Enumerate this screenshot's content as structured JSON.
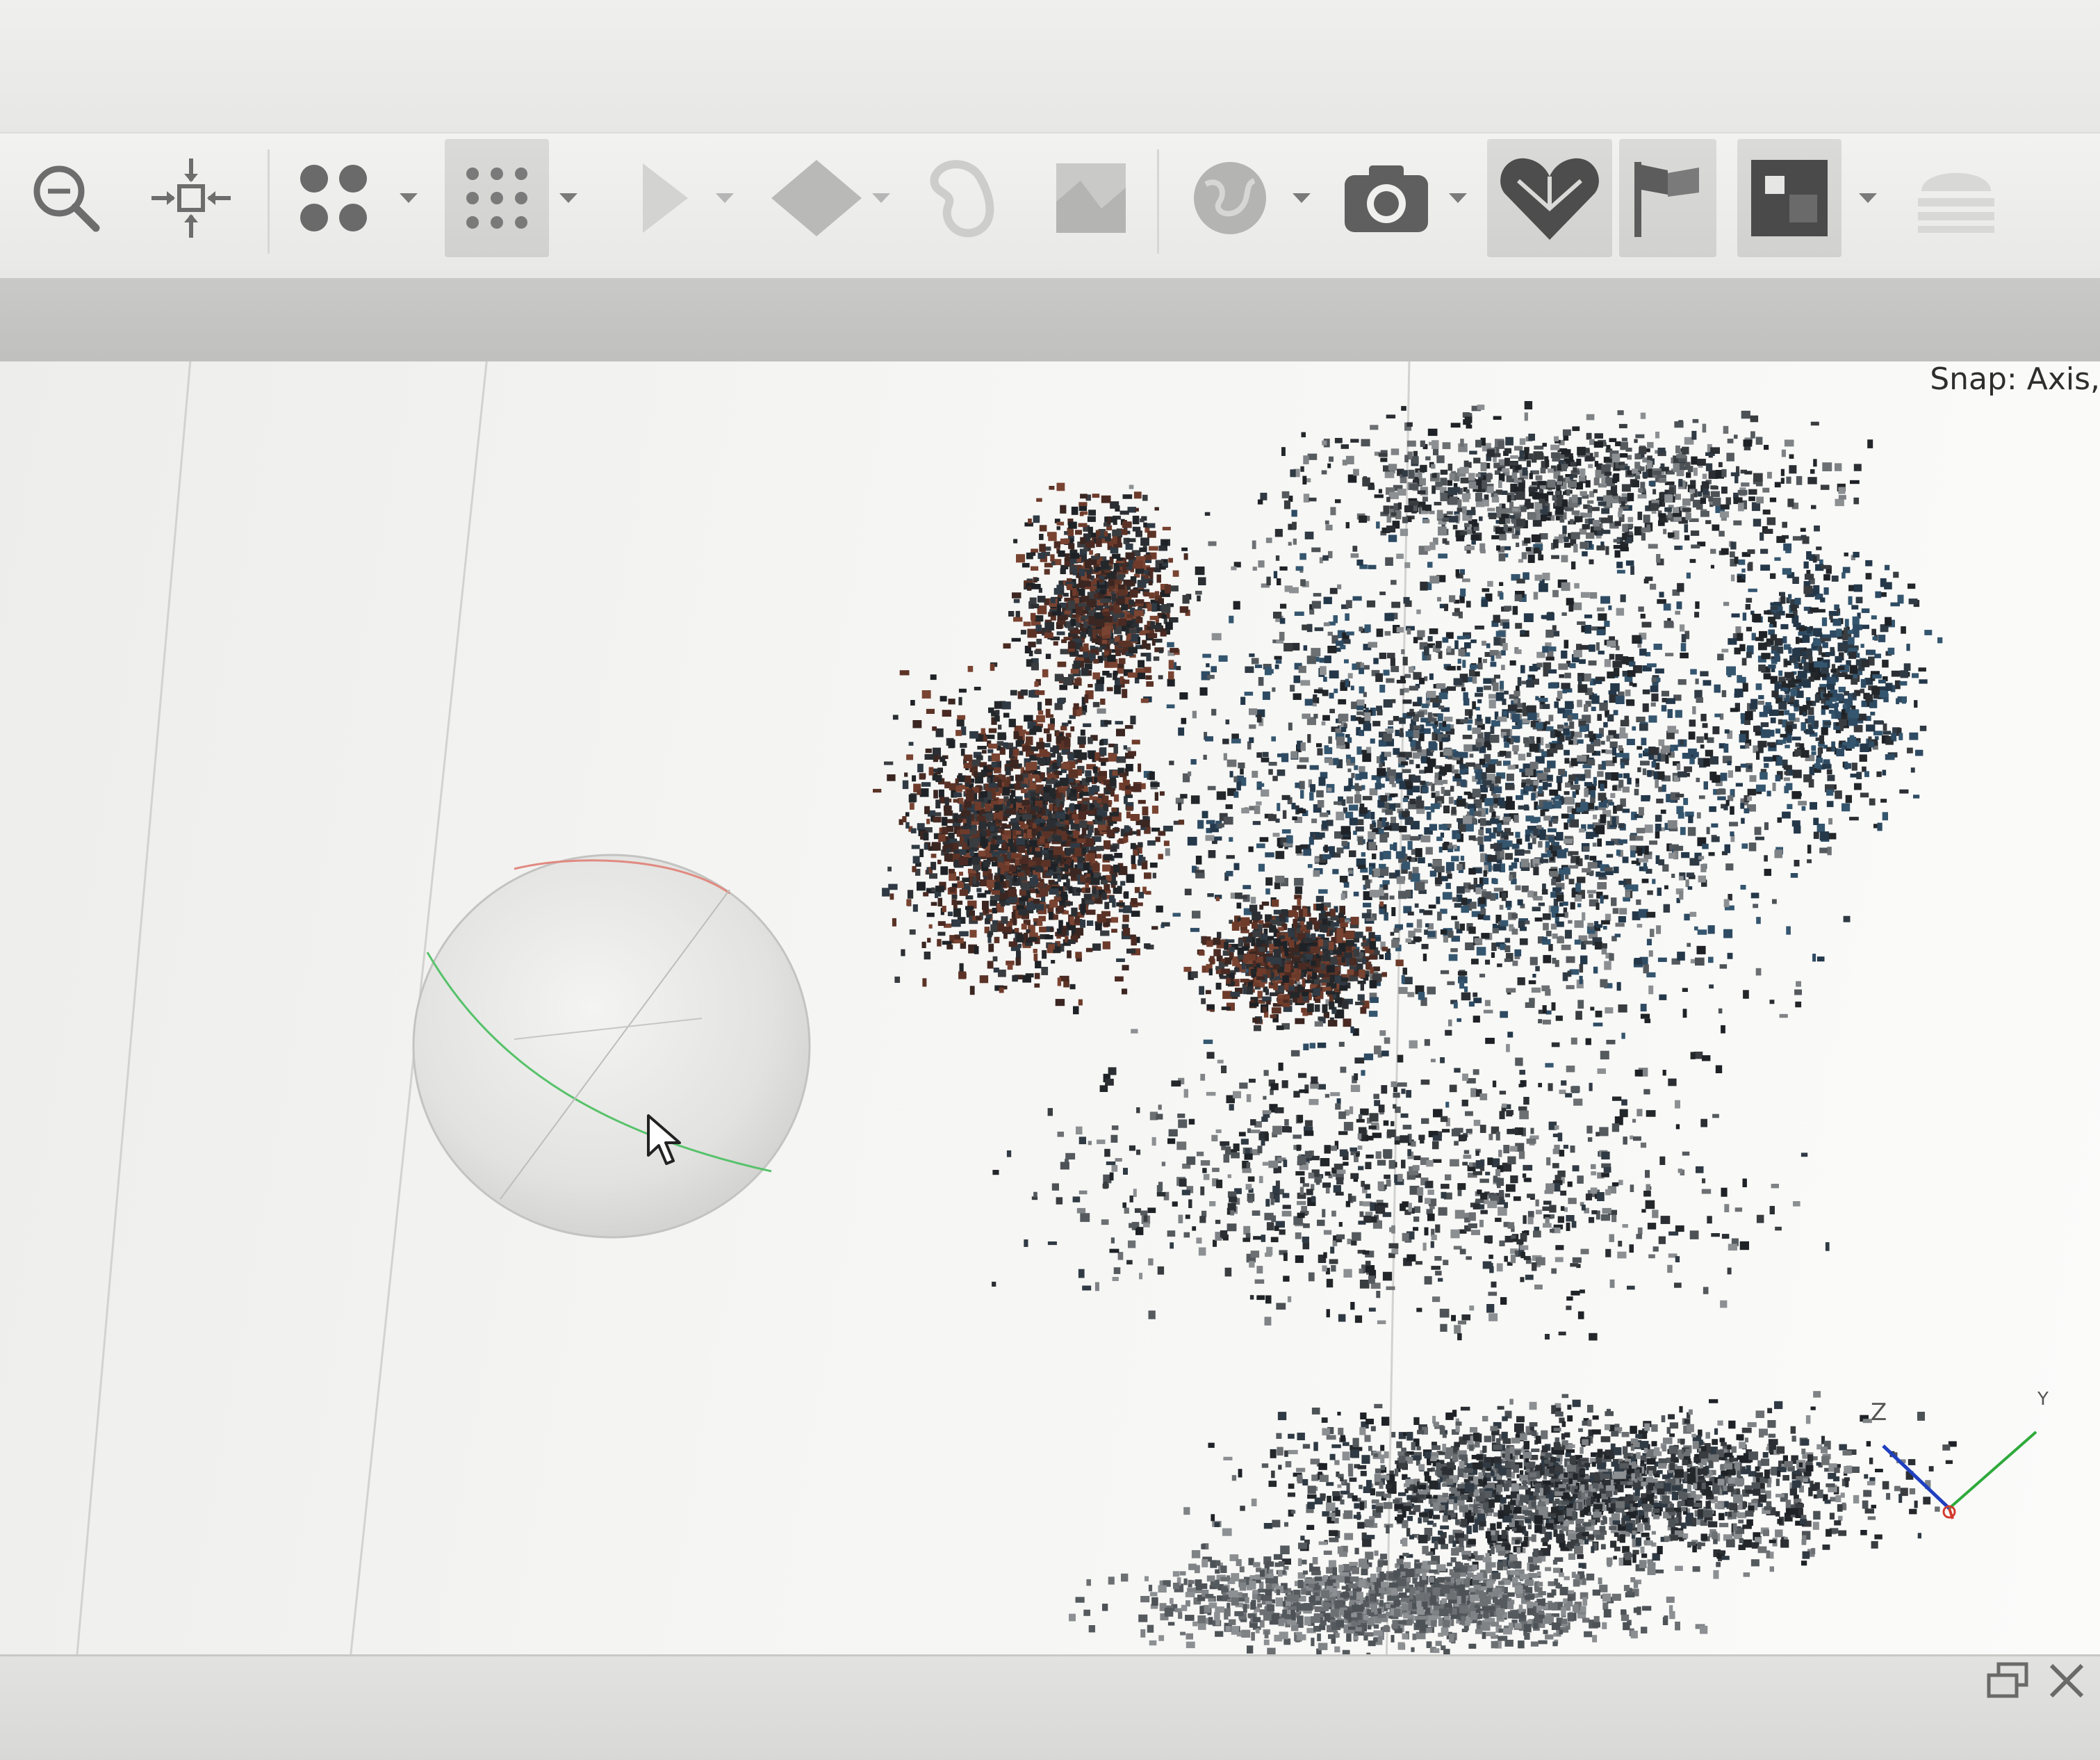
{
  "toolbar": {
    "buttons": [
      {
        "icon": "zoom-out-icon"
      },
      {
        "icon": "move-crosshair-icon"
      },
      {
        "icon": "large-points-icon"
      },
      {
        "icon": "small-points-grid-icon"
      },
      {
        "icon": "pointer-tool-icon"
      },
      {
        "icon": "diamond-shape-icon"
      },
      {
        "icon": "lasso-tool-icon"
      },
      {
        "icon": "texture-tile-icon"
      },
      {
        "icon": "globe-icon"
      },
      {
        "icon": "camera-icon"
      },
      {
        "icon": "heart-mesh-icon"
      },
      {
        "icon": "flag-icon"
      },
      {
        "icon": "image-frame-icon"
      },
      {
        "icon": "stack-layers-icon"
      }
    ]
  },
  "viewport": {
    "snap_label": "Snap: Axis,",
    "axis_labels": {
      "z": "Z",
      "y": "Y"
    }
  },
  "status_bar": {
    "icons": [
      "restore-window-icon",
      "close-icon"
    ]
  },
  "colors": {
    "axis_z": "#1f3fbf",
    "axis_y": "#2faa3c",
    "axis_x": "#d33a2f",
    "orbit_green": "#57c26a",
    "orbit_red": "#e08a80"
  }
}
